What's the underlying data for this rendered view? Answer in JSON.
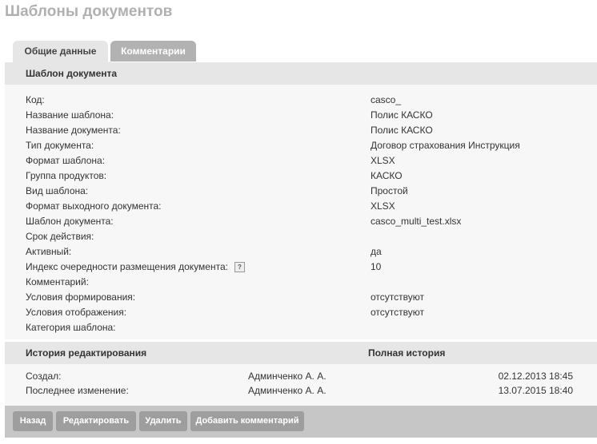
{
  "page": {
    "title": "Шаблоны документов"
  },
  "tabs": [
    {
      "label": "Общие данные",
      "active": true
    },
    {
      "label": "Комментарии",
      "active": false
    }
  ],
  "template_section": {
    "title": "Шаблон документа",
    "fields": [
      {
        "label": "Код:",
        "value": "casco_"
      },
      {
        "label": "Название шаблона:",
        "value": "Полис КАСКО"
      },
      {
        "label": "Название документа:",
        "value": "Полис КАСКО"
      },
      {
        "label": "Тип документа:",
        "value": "Договор страхования Инструкция"
      },
      {
        "label": "Формат шаблона:",
        "value": "XLSX"
      },
      {
        "label": "Группа продуктов:",
        "value": "КАСКО"
      },
      {
        "label": "Вид шаблона:",
        "value": "Простой"
      },
      {
        "label": "Формат выходного документа:",
        "value": "XLSX"
      },
      {
        "label": "Шаблон документа:",
        "value": "casco_multi_test.xlsx"
      },
      {
        "label": "Срок действия:",
        "value": ""
      },
      {
        "label": "Активный:",
        "value": "да"
      },
      {
        "label": "Индекс очередности размещения документа:",
        "value": "10",
        "help_icon": "?"
      },
      {
        "label": "Комментарий:",
        "value": ""
      },
      {
        "label": "Условия формирования:",
        "value": "отсутствуют"
      },
      {
        "label": "Условия отображения:",
        "value": "отсутствуют"
      },
      {
        "label": "Категория шаблона:",
        "value": ""
      }
    ]
  },
  "history_section": {
    "title": "История редактирования",
    "full_history_label": "Полная история",
    "rows": [
      {
        "label": "Создал:",
        "user": "Админченко А. А.",
        "date": "02.12.2013 18:45"
      },
      {
        "label": "Последнее изменение:",
        "user": "Админченко А. А.",
        "date": "13.07.2015 18:40"
      }
    ]
  },
  "toolbar": {
    "back_label": "Назад",
    "edit_label": "Редактировать",
    "delete_label": "Удалить",
    "add_comment_label": "Добавить комментарий"
  }
}
